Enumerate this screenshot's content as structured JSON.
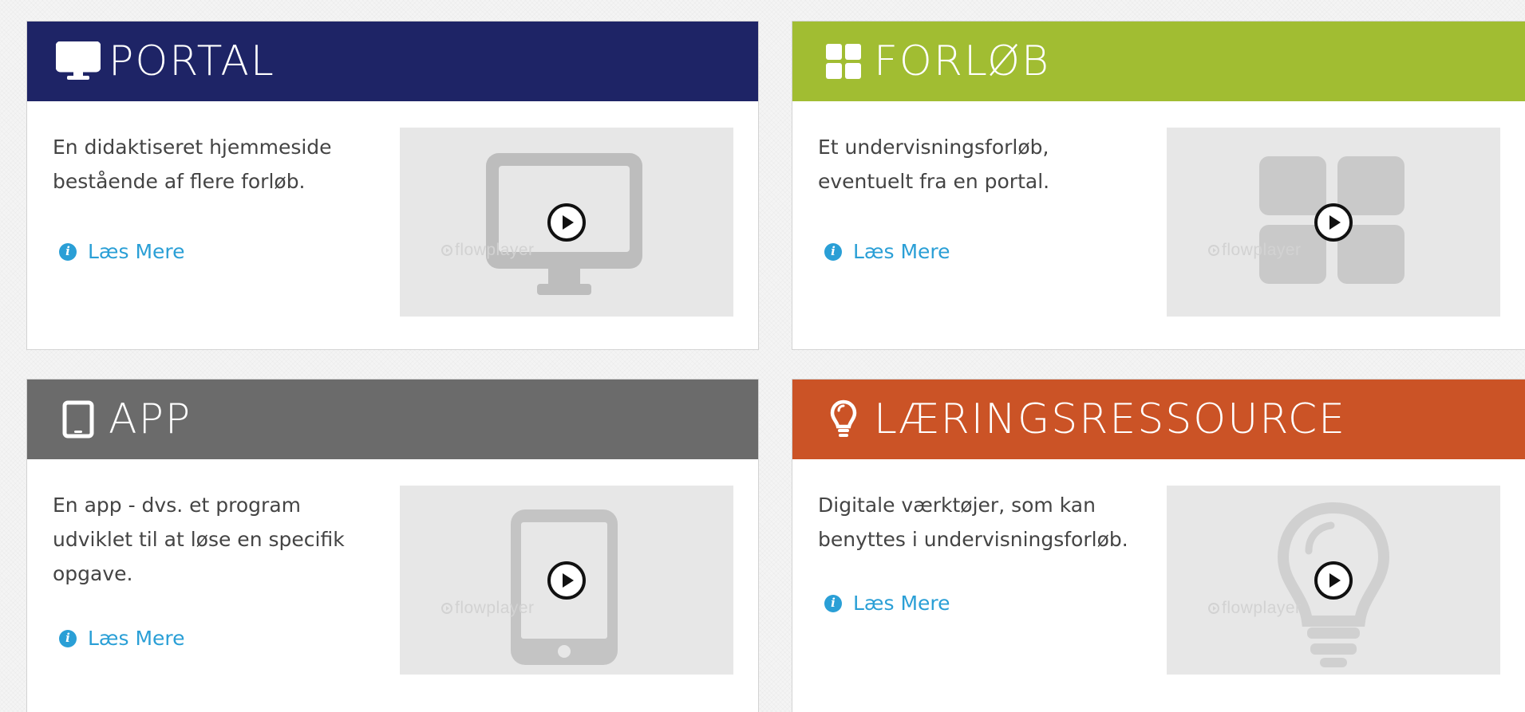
{
  "cards": [
    {
      "title": "PORTAL",
      "description": "En didaktiseret hjemmeside bestående af flere forløb.",
      "read_more": "Læs Mere",
      "header_color": "#1e2466",
      "icon": "monitor-icon"
    },
    {
      "title": "FORLØB",
      "description": "Et undervisningsforløb, eventuelt fra en portal.",
      "read_more": "Læs Mere",
      "header_color": "#a1bd32",
      "icon": "grid-icon"
    },
    {
      "title": "APP",
      "description": "En app - dvs. et program udviklet til at løse en specifik opgave.",
      "read_more": "Læs Mere",
      "header_color": "#6b6b6b",
      "icon": "tablet-icon"
    },
    {
      "title": "LÆRINGSRESSOURCE",
      "description": "Digitale værktøjer, som kan benyttes i undervisningsforløb.",
      "read_more": "Læs Mere",
      "header_color": "#cb5326",
      "icon": "lightbulb-icon"
    }
  ],
  "video": {
    "watermark": "flowplayer"
  },
  "colors": {
    "link": "#2a9fd6",
    "text": "#444444",
    "video_background": "#e7e7e7",
    "placeholder_graphic": "#bdbdbd"
  }
}
